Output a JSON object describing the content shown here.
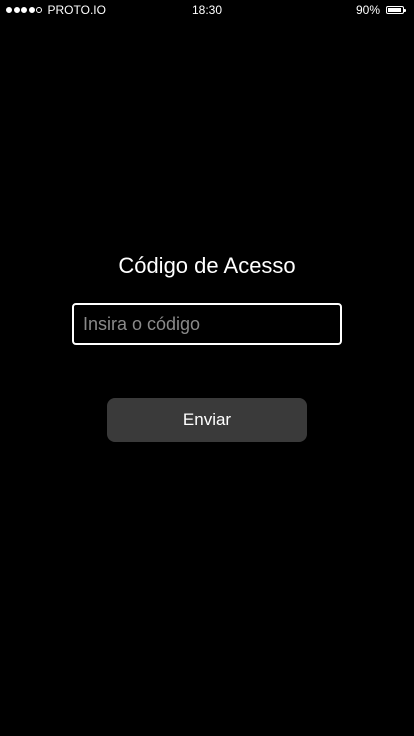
{
  "status_bar": {
    "carrier": "PROTO.IO",
    "time": "18:30",
    "battery_percent": "90%",
    "battery_level": 0.9,
    "signal_bars_filled": 4,
    "signal_bars_total": 5
  },
  "main": {
    "title": "Código de Acesso",
    "code_input": {
      "value": "",
      "placeholder": "Insira o código"
    },
    "submit_label": "Enviar"
  },
  "colors": {
    "background": "#000000",
    "text": "#ffffff",
    "placeholder": "#8a8a8a",
    "button": "#3a3a3a"
  }
}
